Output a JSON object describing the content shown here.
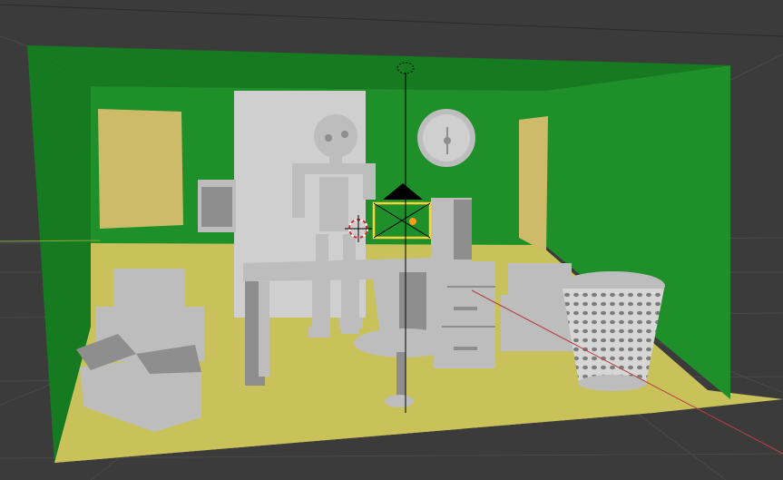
{
  "app": {
    "name": "3D viewport"
  },
  "viewport": {
    "background": "#3b3b3b",
    "grid_color": "#4a4a4a",
    "horizon_line_color": "#2a2a2a",
    "floor_color": "#c9c25a",
    "wall_color": "#1f8f2a",
    "wall_dark_color": "#167a20",
    "paper_color": "#cdbb6a",
    "object_color": "#bdbdbd",
    "object_shadow_color": "#8e8e8e",
    "back_panel_color": "#cfcfcf",
    "x_axis_color": "#b84040",
    "y_axis_color": "#8aa83a",
    "selection_color": "#ffd23a",
    "active_origin_color": "#ff9a1a"
  },
  "scene": {
    "objects": [
      "room-floor",
      "left-wall",
      "back-wall",
      "right-wall",
      "cabinet-panel",
      "wall-clock",
      "paper-left",
      "paper-right",
      "wall-frame",
      "robot-armature",
      "desk",
      "desk-drawers",
      "computer-tower",
      "office-chair",
      "cardboard-boxes-left",
      "cardboard-boxes-right",
      "waste-basket",
      "camera-object",
      "3d-cursor",
      "light-empty"
    ]
  }
}
